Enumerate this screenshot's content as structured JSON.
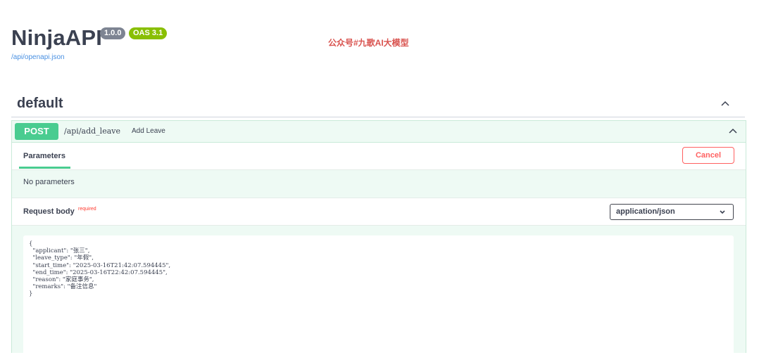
{
  "header": {
    "title": "NinjaAPI",
    "version_badge": "1.0.0",
    "oas_badge": "OAS 3.1",
    "openapi_link": "/api/openapi.json",
    "watermark": "公众号#九歌AI大模型"
  },
  "section": {
    "title": "default",
    "chevron_icon": "chevron-up-icon"
  },
  "operation": {
    "method": "POST",
    "path": "/api/add_leave",
    "summary": "Add Leave",
    "method_color": "#49cc90",
    "chevron_icon": "chevron-up-icon"
  },
  "parameters": {
    "tab_label": "Parameters",
    "cancel_label": "Cancel",
    "empty_text": "No parameters"
  },
  "request_body": {
    "label": "Request body",
    "required_label": "required",
    "content_type": "application/json",
    "body_text": "{\n  \"applicant\": \"张三\",\n  \"leave_type\": \"年假\",\n  \"start_time\": \"2025-03-16T21:42:07.594445\",\n  \"end_time\": \"2025-03-16T22:42:07.594445\",\n  \"reason\": \"家庭事务\",\n  \"remarks\": \"备注信息\"\n}"
  },
  "colors": {
    "accent_green": "#49cc90",
    "cancel_red": "#ff6060",
    "link_blue": "#4990e2"
  }
}
